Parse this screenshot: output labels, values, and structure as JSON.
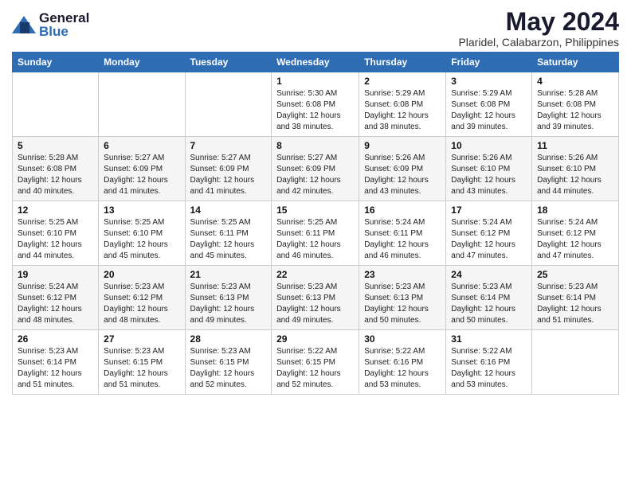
{
  "header": {
    "logo_general": "General",
    "logo_blue": "Blue",
    "title": "May 2024",
    "subtitle": "Plaridel, Calabarzon, Philippines"
  },
  "calendar": {
    "days_of_week": [
      "Sunday",
      "Monday",
      "Tuesday",
      "Wednesday",
      "Thursday",
      "Friday",
      "Saturday"
    ],
    "weeks": [
      [
        {
          "day": "",
          "detail": ""
        },
        {
          "day": "",
          "detail": ""
        },
        {
          "day": "",
          "detail": ""
        },
        {
          "day": "1",
          "detail": "Sunrise: 5:30 AM\nSunset: 6:08 PM\nDaylight: 12 hours\nand 38 minutes."
        },
        {
          "day": "2",
          "detail": "Sunrise: 5:29 AM\nSunset: 6:08 PM\nDaylight: 12 hours\nand 38 minutes."
        },
        {
          "day": "3",
          "detail": "Sunrise: 5:29 AM\nSunset: 6:08 PM\nDaylight: 12 hours\nand 39 minutes."
        },
        {
          "day": "4",
          "detail": "Sunrise: 5:28 AM\nSunset: 6:08 PM\nDaylight: 12 hours\nand 39 minutes."
        }
      ],
      [
        {
          "day": "5",
          "detail": "Sunrise: 5:28 AM\nSunset: 6:08 PM\nDaylight: 12 hours\nand 40 minutes."
        },
        {
          "day": "6",
          "detail": "Sunrise: 5:27 AM\nSunset: 6:09 PM\nDaylight: 12 hours\nand 41 minutes."
        },
        {
          "day": "7",
          "detail": "Sunrise: 5:27 AM\nSunset: 6:09 PM\nDaylight: 12 hours\nand 41 minutes."
        },
        {
          "day": "8",
          "detail": "Sunrise: 5:27 AM\nSunset: 6:09 PM\nDaylight: 12 hours\nand 42 minutes."
        },
        {
          "day": "9",
          "detail": "Sunrise: 5:26 AM\nSunset: 6:09 PM\nDaylight: 12 hours\nand 43 minutes."
        },
        {
          "day": "10",
          "detail": "Sunrise: 5:26 AM\nSunset: 6:10 PM\nDaylight: 12 hours\nand 43 minutes."
        },
        {
          "day": "11",
          "detail": "Sunrise: 5:26 AM\nSunset: 6:10 PM\nDaylight: 12 hours\nand 44 minutes."
        }
      ],
      [
        {
          "day": "12",
          "detail": "Sunrise: 5:25 AM\nSunset: 6:10 PM\nDaylight: 12 hours\nand 44 minutes."
        },
        {
          "day": "13",
          "detail": "Sunrise: 5:25 AM\nSunset: 6:10 PM\nDaylight: 12 hours\nand 45 minutes."
        },
        {
          "day": "14",
          "detail": "Sunrise: 5:25 AM\nSunset: 6:11 PM\nDaylight: 12 hours\nand 45 minutes."
        },
        {
          "day": "15",
          "detail": "Sunrise: 5:25 AM\nSunset: 6:11 PM\nDaylight: 12 hours\nand 46 minutes."
        },
        {
          "day": "16",
          "detail": "Sunrise: 5:24 AM\nSunset: 6:11 PM\nDaylight: 12 hours\nand 46 minutes."
        },
        {
          "day": "17",
          "detail": "Sunrise: 5:24 AM\nSunset: 6:12 PM\nDaylight: 12 hours\nand 47 minutes."
        },
        {
          "day": "18",
          "detail": "Sunrise: 5:24 AM\nSunset: 6:12 PM\nDaylight: 12 hours\nand 47 minutes."
        }
      ],
      [
        {
          "day": "19",
          "detail": "Sunrise: 5:24 AM\nSunset: 6:12 PM\nDaylight: 12 hours\nand 48 minutes."
        },
        {
          "day": "20",
          "detail": "Sunrise: 5:23 AM\nSunset: 6:12 PM\nDaylight: 12 hours\nand 48 minutes."
        },
        {
          "day": "21",
          "detail": "Sunrise: 5:23 AM\nSunset: 6:13 PM\nDaylight: 12 hours\nand 49 minutes."
        },
        {
          "day": "22",
          "detail": "Sunrise: 5:23 AM\nSunset: 6:13 PM\nDaylight: 12 hours\nand 49 minutes."
        },
        {
          "day": "23",
          "detail": "Sunrise: 5:23 AM\nSunset: 6:13 PM\nDaylight: 12 hours\nand 50 minutes."
        },
        {
          "day": "24",
          "detail": "Sunrise: 5:23 AM\nSunset: 6:14 PM\nDaylight: 12 hours\nand 50 minutes."
        },
        {
          "day": "25",
          "detail": "Sunrise: 5:23 AM\nSunset: 6:14 PM\nDaylight: 12 hours\nand 51 minutes."
        }
      ],
      [
        {
          "day": "26",
          "detail": "Sunrise: 5:23 AM\nSunset: 6:14 PM\nDaylight: 12 hours\nand 51 minutes."
        },
        {
          "day": "27",
          "detail": "Sunrise: 5:23 AM\nSunset: 6:15 PM\nDaylight: 12 hours\nand 51 minutes."
        },
        {
          "day": "28",
          "detail": "Sunrise: 5:23 AM\nSunset: 6:15 PM\nDaylight: 12 hours\nand 52 minutes."
        },
        {
          "day": "29",
          "detail": "Sunrise: 5:22 AM\nSunset: 6:15 PM\nDaylight: 12 hours\nand 52 minutes."
        },
        {
          "day": "30",
          "detail": "Sunrise: 5:22 AM\nSunset: 6:16 PM\nDaylight: 12 hours\nand 53 minutes."
        },
        {
          "day": "31",
          "detail": "Sunrise: 5:22 AM\nSunset: 6:16 PM\nDaylight: 12 hours\nand 53 minutes."
        },
        {
          "day": "",
          "detail": ""
        }
      ]
    ]
  }
}
